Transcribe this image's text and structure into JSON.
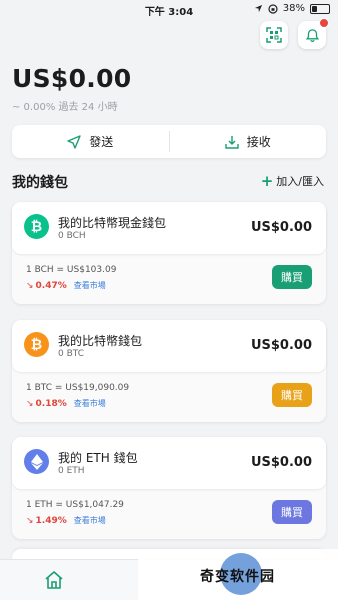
{
  "status_bar": {
    "time": "下午 3:04",
    "battery": "38%",
    "battery_level": 0.38
  },
  "portfolio": {
    "total": "US$0.00",
    "change_label": "~ 0.00% 過去 24 小時"
  },
  "actions": {
    "send": "發送",
    "receive": "接收"
  },
  "section": {
    "title": "我的錢包",
    "add_import": "加入/匯入"
  },
  "colors": {
    "accent": "#1a9e74",
    "bch": "#0ac18e",
    "btc": "#f7931a",
    "eth": "#627eea",
    "negative": "#e0443a",
    "link": "#3b7ddd"
  },
  "wallets": [
    {
      "icon": "bitcoin-cash-icon",
      "name": "我的比特幣現金錢包",
      "symbol": "0 BCH",
      "balance": "US$0.00",
      "rate": "1 BCH = US$103.09",
      "change": "0.47%",
      "market": "查看市場",
      "buy": "購買",
      "buy_color": "#1a9e74"
    },
    {
      "icon": "bitcoin-icon",
      "name": "我的比特幣錢包",
      "symbol": "0 BTC",
      "balance": "US$0.00",
      "rate": "1 BTC = US$19,090.09",
      "change": "0.18%",
      "market": "查看市場",
      "buy": "購買",
      "buy_color": "#e8a219"
    },
    {
      "icon": "ethereum-icon",
      "name": "我的 ETH 錢包",
      "symbol": "0 ETH",
      "balance": "US$0.00",
      "rate": "1 ETH = US$1,047.29",
      "change": "1.49%",
      "market": "查看市場",
      "buy": "購買",
      "buy_color": "#6c78e0"
    }
  ],
  "watermark": {
    "text": "奇变软件园"
  }
}
